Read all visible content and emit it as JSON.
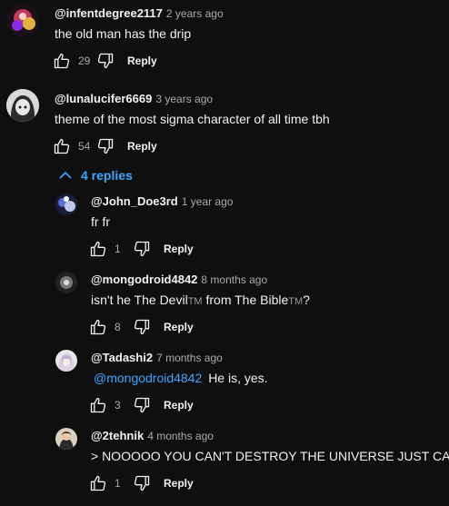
{
  "comments": [
    {
      "author": "@infentdegree2117",
      "time": "2 years ago",
      "text": "the old man has the drip",
      "likes": "29",
      "reply_label": "Reply"
    },
    {
      "author": "@lunalucifer6669",
      "time": "3 years ago",
      "text": "theme of the most sigma character of all time tbh",
      "likes": "54",
      "reply_label": "Reply",
      "replies_toggle": "4 replies"
    }
  ],
  "replies": [
    {
      "author": "@John_Doe3rd",
      "time": "1 year ago",
      "text": "fr fr",
      "likes": "1",
      "reply_label": "Reply"
    },
    {
      "author": "@mongodroid4842",
      "time": "8 months ago",
      "text_parts": [
        "isn't he The Devil",
        "TM",
        " from The Bible",
        "TM",
        "?"
      ],
      "likes": "8",
      "reply_label": "Reply"
    },
    {
      "author": "@Tadashi2",
      "time": "7 months ago",
      "mention": "@mongodroid4842",
      "text": "He is, yes.",
      "likes": "3",
      "reply_label": "Reply"
    },
    {
      "author": "@2tehnik",
      "time": "4 months ago",
      "text": "> NOOOOO YOU CAN'T DESTROY THE UNIVERSE JUST CAUSE G",
      "likes": "1",
      "reply_label": "Reply"
    }
  ],
  "icons": {
    "like": "thumb-up-icon",
    "dislike": "thumb-down-icon",
    "collapse": "chevron-up-icon"
  },
  "colors": {
    "background": "#0f0f0f",
    "text": "#f1f1f1",
    "muted": "#aaaaaa",
    "link": "#3ea6ff"
  }
}
